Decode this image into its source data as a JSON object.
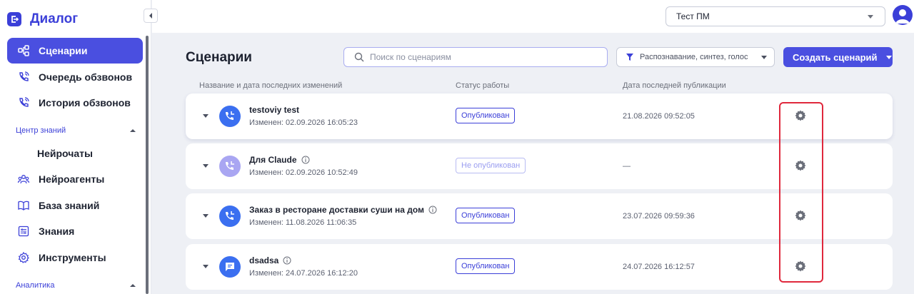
{
  "app": {
    "title": "Диалог"
  },
  "sidebar": {
    "items": [
      {
        "label": "Сценарии",
        "icon": "scenarios-icon"
      },
      {
        "label": "Очередь обзвонов",
        "icon": "phone-queue-icon"
      },
      {
        "label": "История обзвонов",
        "icon": "phone-history-icon"
      },
      {
        "label": "Нейрочаты"
      },
      {
        "label": "Нейроагенты",
        "icon": "agents-icon"
      },
      {
        "label": "База знаний",
        "icon": "book-icon"
      },
      {
        "label": "Знания",
        "icon": "knowledge-icon"
      },
      {
        "label": "Инструменты",
        "icon": "gear-icon"
      }
    ],
    "sections": {
      "knowledge": "Центр знаний",
      "analytics": "Аналитика"
    }
  },
  "header": {
    "project": "Тест ПМ"
  },
  "main": {
    "title": "Сценарии",
    "search_placeholder": "Поиск по сценариям",
    "filter_label": "Распознавание, синтез, голос",
    "create_label": "Создать сценарий",
    "columns": [
      "Название и дата последних изменений",
      "Статус работы",
      "Дата последней публикации"
    ],
    "rows": [
      {
        "name": "testoviy test",
        "changed": "Изменен: 02.09.2026 16:05:23",
        "status": "Опубликован",
        "published": "21.08.2026 09:52:05",
        "icon": "phone-flow-icon",
        "info": false
      },
      {
        "name": "Для Claude",
        "changed": "Изменен: 02.09.2026 10:52:49",
        "status": "Не опубликован",
        "published": "—",
        "icon": "phone-flow-icon",
        "info": true
      },
      {
        "name": "Заказ в ресторане доставки суши на дом",
        "changed": "Изменен: 11.08.2026 11:06:35",
        "status": "Опубликован",
        "published": "23.07.2026 09:59:36",
        "icon": "phone-flow-icon",
        "info": true
      },
      {
        "name": "dsadsa",
        "changed": "Изменен: 24.07.2026 16:12:20",
        "status": "Опубликован",
        "published": "24.07.2026 16:12:57",
        "icon": "chat-icon",
        "info": true
      }
    ]
  },
  "colors": {
    "accent": "#4a4fe0",
    "brand": "#3b3fd8",
    "row_icon": "#3b6ff0",
    "row_icon_muted": "#a9a6f2",
    "highlight": "#e0283c"
  }
}
